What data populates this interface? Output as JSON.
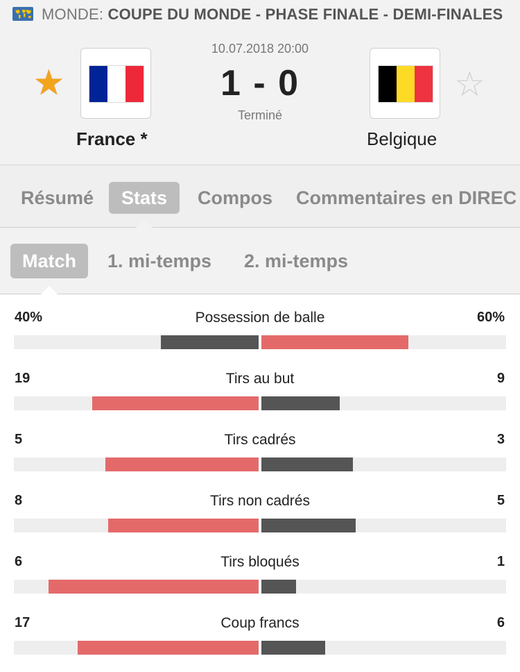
{
  "header": {
    "country": "MONDE:",
    "competition": "COUPE DU MONDE - PHASE FINALE - DEMI-FINALES",
    "icon": "world-map-icon"
  },
  "match": {
    "date": "10.07.2018 20:00",
    "score": "1 - 0",
    "status": "Terminé",
    "home": {
      "name": "France *",
      "favorite": true,
      "flag_colors": [
        "#002395",
        "#ffffff",
        "#ed2939"
      ]
    },
    "away": {
      "name": "Belgique",
      "favorite": false,
      "flag_colors": [
        "#000000",
        "#fdda24",
        "#ef3340"
      ]
    }
  },
  "tabs": [
    {
      "label": "Résumé",
      "active": false
    },
    {
      "label": "Stats",
      "active": true
    },
    {
      "label": "Compos",
      "active": false
    },
    {
      "label": "Commentaires en DIREC",
      "active": false
    }
  ],
  "subtabs": [
    {
      "label": "Match",
      "active": true
    },
    {
      "label": "1. mi-temps",
      "active": false
    },
    {
      "label": "2. mi-temps",
      "active": false
    }
  ],
  "colors": {
    "leader": "#e46a6a",
    "trailer": "#555555",
    "track": "#eeeeee"
  },
  "stats": [
    {
      "label": "Possession de balle",
      "home": "40%",
      "away": "60%",
      "home_val": 40,
      "away_val": 60
    },
    {
      "label": "Tirs au but",
      "home": "19",
      "away": "9",
      "home_val": 19,
      "away_val": 9
    },
    {
      "label": "Tirs cadrés",
      "home": "5",
      "away": "3",
      "home_val": 5,
      "away_val": 3
    },
    {
      "label": "Tirs non cadrés",
      "home": "8",
      "away": "5",
      "home_val": 8,
      "away_val": 5
    },
    {
      "label": "Tirs bloqués",
      "home": "6",
      "away": "1",
      "home_val": 6,
      "away_val": 1
    },
    {
      "label": "Coup francs",
      "home": "17",
      "away": "6",
      "home_val": 17,
      "away_val": 6
    }
  ]
}
